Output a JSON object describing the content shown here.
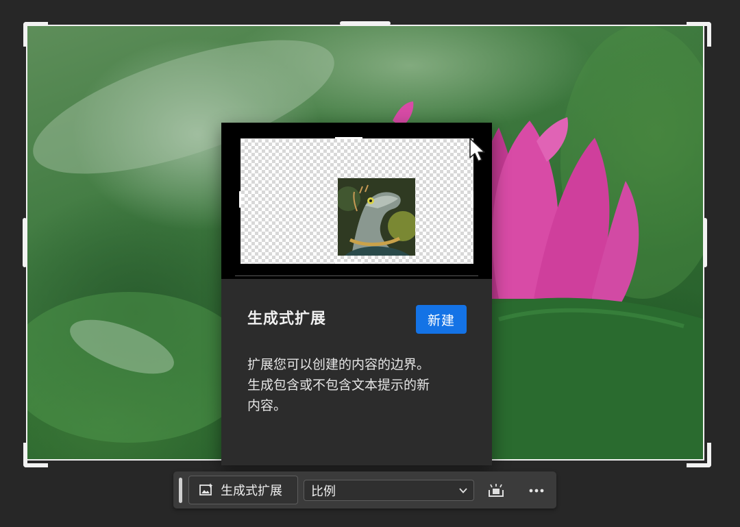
{
  "popup": {
    "title": "生成式扩展",
    "badge": "新建",
    "description_lines": [
      "扩展您可以创建的内容的边界。",
      "生成包含或不包含文本提示的新",
      "内容。"
    ]
  },
  "taskbar": {
    "generative_expand_label": "生成式扩展",
    "ratio_value": "比例"
  },
  "colors": {
    "badge_blue": "#1473e6",
    "popup_bg": "#2c2c2c",
    "taskbar_bg": "#3b3b3b",
    "canvas_bg": "#272727",
    "lotus_pink": "#d23f9e"
  },
  "icons": {
    "generative_expand": "generative-expand-icon",
    "select_chevron": "chevron-down-icon",
    "reset": "reset-crop-icon",
    "more": "more-options-icon",
    "cursor": "arrow-cursor-icon"
  }
}
